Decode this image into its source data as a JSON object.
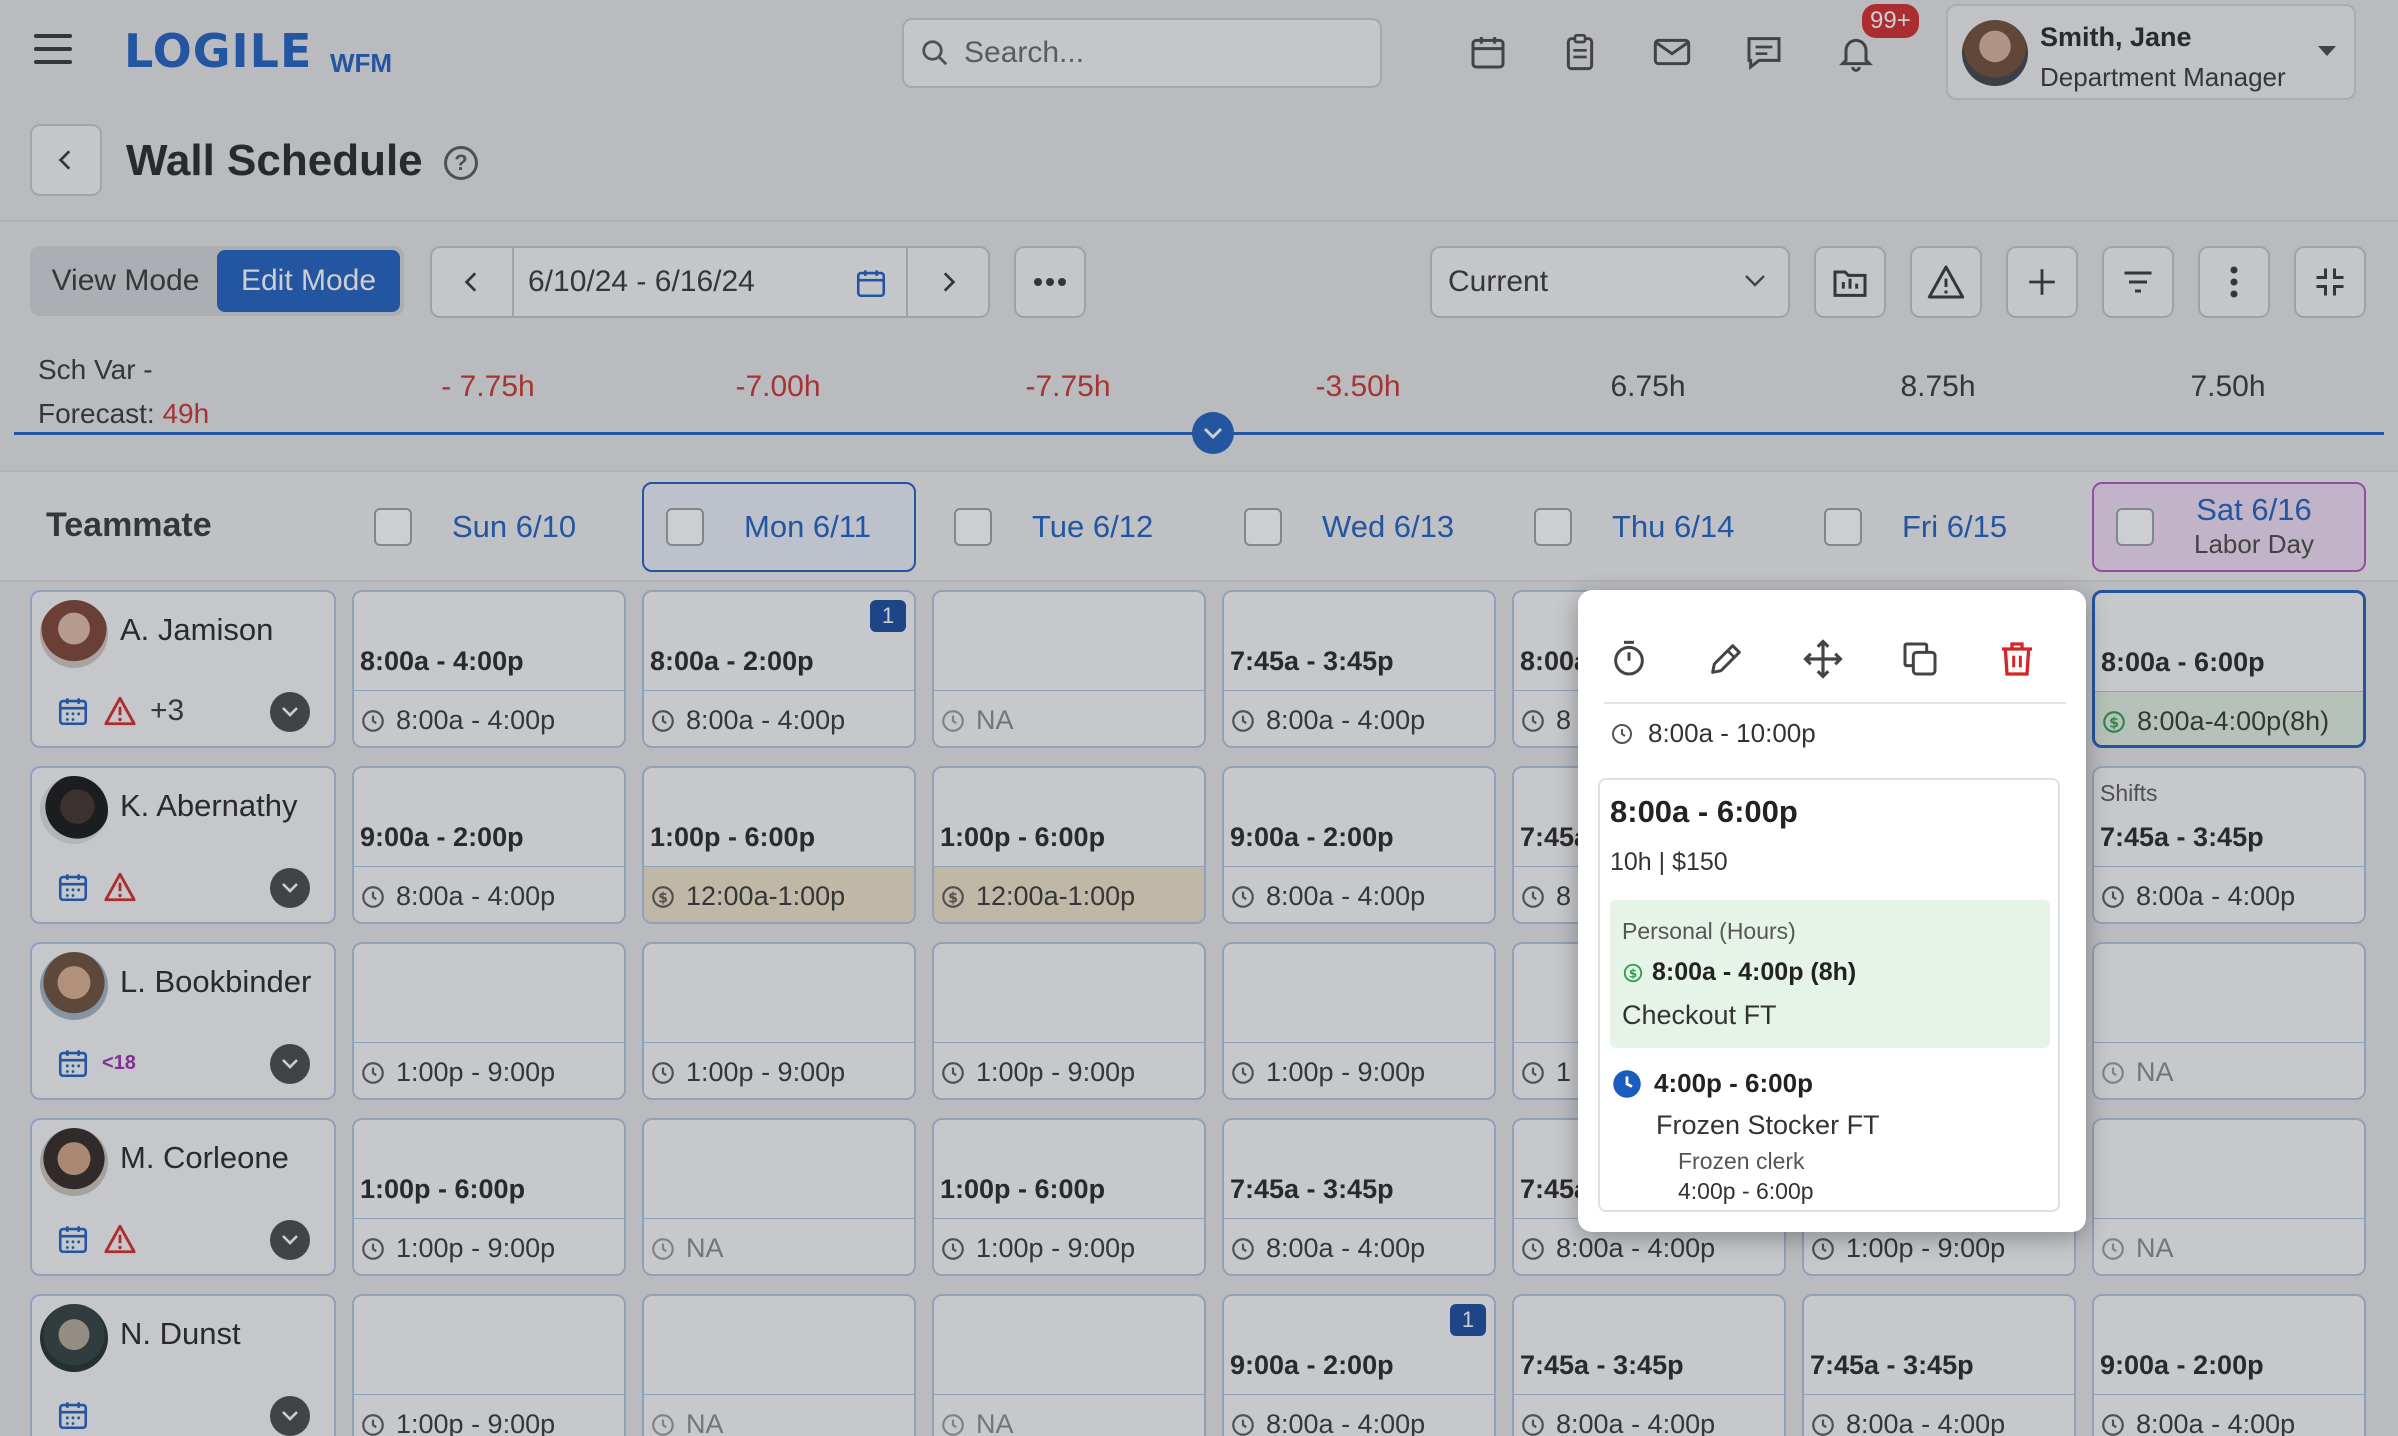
{
  "app": {
    "logo": "LOGILE",
    "logo_sub": "WFM"
  },
  "search": {
    "placeholder": "Search..."
  },
  "notifications": {
    "badge": "99+"
  },
  "user": {
    "name": "Smith, Jane",
    "role": "Department Manager"
  },
  "page": {
    "title": "Wall Schedule",
    "help_glyph": "?"
  },
  "toolbar": {
    "view_mode": "View Mode",
    "edit_mode": "Edit Mode",
    "date_range": "6/10/24 - 6/16/24",
    "schedule_select": "Current"
  },
  "variance": {
    "label_line1": "Sch Var -",
    "label_line2": "Forecast:",
    "total": "49h",
    "values": [
      "- 7.75h",
      "-7.00h",
      "-7.75h",
      "-3.50h",
      "6.75h",
      "8.75h",
      "7.50h"
    ],
    "negative": [
      true,
      true,
      true,
      true,
      false,
      false,
      false
    ]
  },
  "header": {
    "teammate_label": "Teammate",
    "days": [
      {
        "label": "Sun 6/10"
      },
      {
        "label": "Mon 6/11"
      },
      {
        "label": "Tue 6/12"
      },
      {
        "label": "Wed 6/13"
      },
      {
        "label": "Thu 6/14"
      },
      {
        "label": "Fri 6/15"
      },
      {
        "label": "Sat 6/16",
        "sub": "Labor Day"
      }
    ]
  },
  "teammates": [
    {
      "name": "A. Jamison",
      "extra": "+3",
      "warning": true
    },
    {
      "name": "K. Abernathy",
      "warning": true
    },
    {
      "name": "L. Bookbinder",
      "tag": "<18"
    },
    {
      "name": "M. Corleone",
      "warning": true
    },
    {
      "name": "N. Dunst"
    }
  ],
  "schedule": [
    [
      {
        "shift": "8:00a - 4:00p",
        "avail": "8:00a - 4:00p"
      },
      {
        "shift": "8:00a - 2:00p",
        "avail": "8:00a - 4:00p",
        "count": "1"
      },
      {
        "shift": "",
        "avail": "NA"
      },
      {
        "shift": "7:45a - 3:45p",
        "avail": "8:00a - 4:00p"
      },
      {
        "shift": "8:00a",
        "avail": "8"
      },
      {
        "shift": "",
        "avail": ""
      },
      {
        "shift": "8:00a - 6:00p",
        "avail": "8:00a-4:00p(8h)"
      }
    ],
    [
      {
        "shift": "9:00a - 2:00p",
        "avail": "8:00a - 4:00p"
      },
      {
        "shift": "1:00p - 6:00p",
        "avail": "12:00a-1:00p"
      },
      {
        "shift": "1:00p - 6:00p",
        "avail": "12:00a-1:00p"
      },
      {
        "shift": "9:00a - 2:00p",
        "avail": "8:00a - 4:00p"
      },
      {
        "shift": "7:45a",
        "avail": "8"
      },
      {
        "shift": "",
        "avail": ""
      },
      {
        "top_label": "Shifts",
        "shift": "7:45a - 3:45p",
        "avail": "8:00a - 4:00p"
      }
    ],
    [
      {
        "shift": "",
        "avail": "1:00p - 9:00p"
      },
      {
        "shift": "",
        "avail": "1:00p - 9:00p"
      },
      {
        "shift": "",
        "avail": "1:00p - 9:00p"
      },
      {
        "shift": "",
        "avail": "1:00p - 9:00p"
      },
      {
        "shift": "",
        "avail": "1"
      },
      {
        "shift": "",
        "avail": ""
      },
      {
        "shift": "",
        "avail": "NA"
      }
    ],
    [
      {
        "shift": "1:00p - 6:00p",
        "avail": "1:00p - 9:00p"
      },
      {
        "shift": "",
        "avail": "NA"
      },
      {
        "shift": "1:00p - 6:00p",
        "avail": "1:00p - 9:00p"
      },
      {
        "shift": "7:45a - 3:45p",
        "avail": "8:00a - 4:00p"
      },
      {
        "shift": "7:45a",
        "avail": "8:00a - 4:00p"
      },
      {
        "shift": "",
        "avail": "1:00p - 9:00p"
      },
      {
        "shift": "",
        "avail": "NA"
      }
    ],
    [
      {
        "shift": "",
        "avail": "1:00p - 9:00p"
      },
      {
        "shift": "",
        "avail": "NA"
      },
      {
        "shift": "",
        "avail": "NA"
      },
      {
        "shift": "9:00a - 2:00p",
        "avail": "8:00a - 4:00p",
        "count": "1"
      },
      {
        "shift": "7:45a - 3:45p",
        "avail": "8:00a - 4:00p"
      },
      {
        "shift": "7:45a - 3:45p",
        "avail": "8:00a - 4:00p"
      },
      {
        "shift": "9:00a - 2:00p",
        "avail": "8:00a - 4:00p"
      }
    ]
  ],
  "popup": {
    "availability": "8:00a - 10:00p",
    "shift": "8:00a - 6:00p",
    "meta": "10h | $150",
    "paid_category": "Personal (Hours)",
    "paid_time": "8:00a - 4:00p (8h)",
    "paid_job": "Checkout FT",
    "segment_time": "4:00p - 6:00p",
    "segment_job": "Frozen Stocker FT",
    "segment_role": "Frozen clerk",
    "segment_role_time": "4:00p - 6:00p"
  },
  "colors": {
    "accent": "#1a5cc0",
    "negative": "#c9302c",
    "holiday": "#b64fc9",
    "delete": "#d32626"
  }
}
